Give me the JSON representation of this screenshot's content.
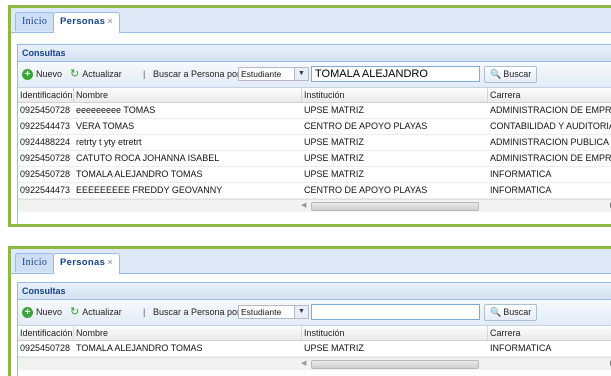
{
  "tabs": {
    "inicio": "Inicio",
    "personas": "Personas",
    "close": "×"
  },
  "panel_title": "Consultas",
  "toolbar": {
    "nuevo": "Nuevo",
    "actualizar": "Actualizar",
    "separator": "|",
    "buscar_por_label": "Buscar a Persona por:",
    "combo_value": "Estudiante",
    "buscar": "Buscar"
  },
  "columns": [
    "Identificación",
    "Nombre",
    "Institución",
    "Carrera"
  ],
  "view1": {
    "search_value": "TOMALA ALEJANDRO",
    "rows": [
      [
        "0925450728",
        "eeeeeeeee TOMAS",
        "UPSE MATRIZ",
        "ADMINISTRACION DE EMPRESAS"
      ],
      [
        "0922544473",
        "VERA TOMAS",
        "CENTRO DE APOYO PLAYAS",
        "CONTABILIDAD Y AUDITORIA"
      ],
      [
        "0924488224",
        "retrty t yty etretrt",
        "UPSE MATRIZ",
        "ADMINISTRACION PUBLICA"
      ],
      [
        "0925450728",
        "CATUTO ROCA JOHANNA ISABEL",
        "UPSE MATRIZ",
        "ADMINISTRACION DE EMPRESAS"
      ],
      [
        "0925450728",
        "TOMALA ALEJANDRO TOMAS",
        "UPSE MATRIZ",
        "INFORMATICA"
      ],
      [
        "0922544473",
        "EEEEEEEEE FREDDY GEOVANNY",
        "CENTRO DE APOYO PLAYAS",
        "INFORMATICA"
      ]
    ]
  },
  "view2": {
    "search_value": "",
    "rows": [
      [
        "0925450728",
        "TOMALA ALEJANDRO TOMAS",
        "UPSE MATRIZ",
        "INFORMATICA"
      ]
    ]
  },
  "colors": {
    "frame": "#8db845",
    "header_text": "#15428b"
  }
}
